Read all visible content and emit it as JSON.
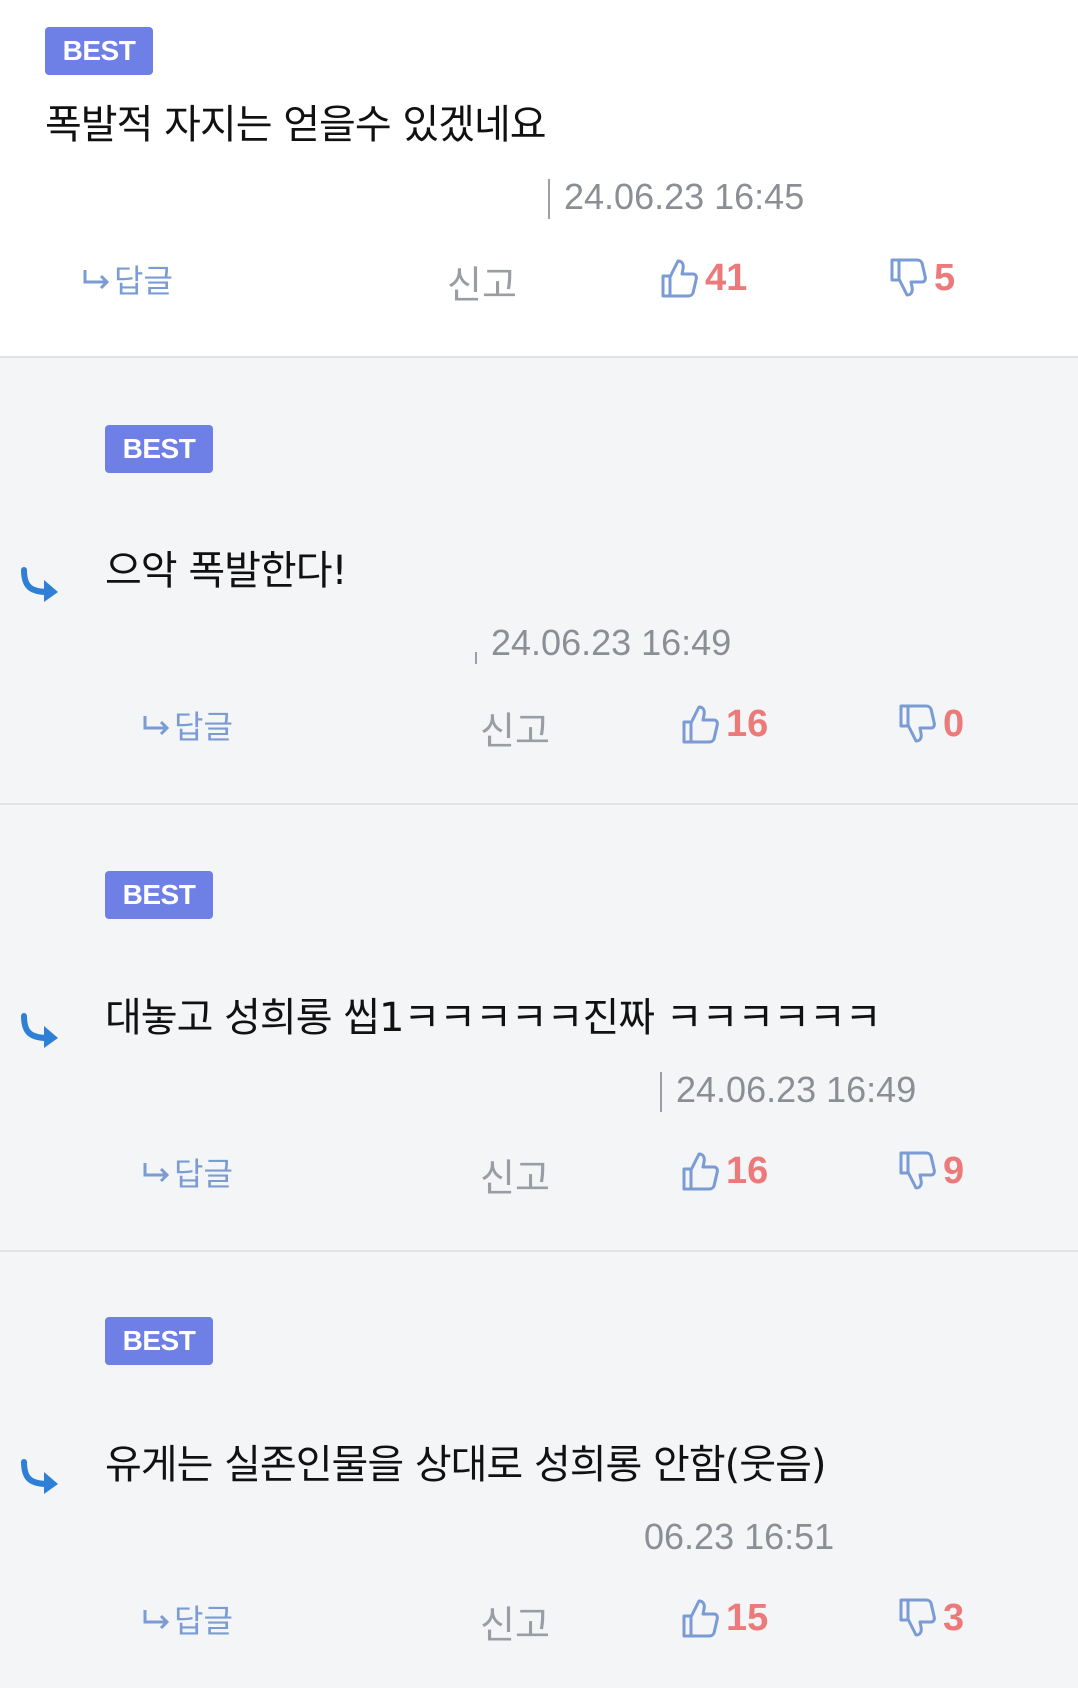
{
  "colors": {
    "badge": "#6e7fe6",
    "vote_count": "#ec7a7a",
    "icon_blue": "#7a9bd4",
    "reply_arrow": "#2f7fd6"
  },
  "comments": [
    {
      "badge": "BEST",
      "text": "폭발적 자지는 얻을수 있겠네요",
      "time": "24.06.23 16:45",
      "reply_label": "답글",
      "report_label": "신고",
      "likes": "41",
      "dislikes": "5"
    },
    {
      "badge": "BEST",
      "text": "으악 폭발한다!",
      "time": "24.06.23 16:49",
      "reply_label": "답글",
      "report_label": "신고",
      "likes": "16",
      "dislikes": "0"
    },
    {
      "badge": "BEST",
      "text": "대놓고 성희롱 씹1ㅋㅋㅋㅋㅋ진짜 ㅋㅋㅋㅋㅋㅋ",
      "time": "24.06.23 16:49",
      "reply_label": "답글",
      "report_label": "신고",
      "likes": "16",
      "dislikes": "9"
    },
    {
      "badge": "BEST",
      "text": "유게는 실존인물을 상대로 성희롱 안함(웃음)",
      "time": "06.23 16:51",
      "reply_label": "답글",
      "report_label": "신고",
      "likes": "15",
      "dislikes": "3"
    }
  ]
}
